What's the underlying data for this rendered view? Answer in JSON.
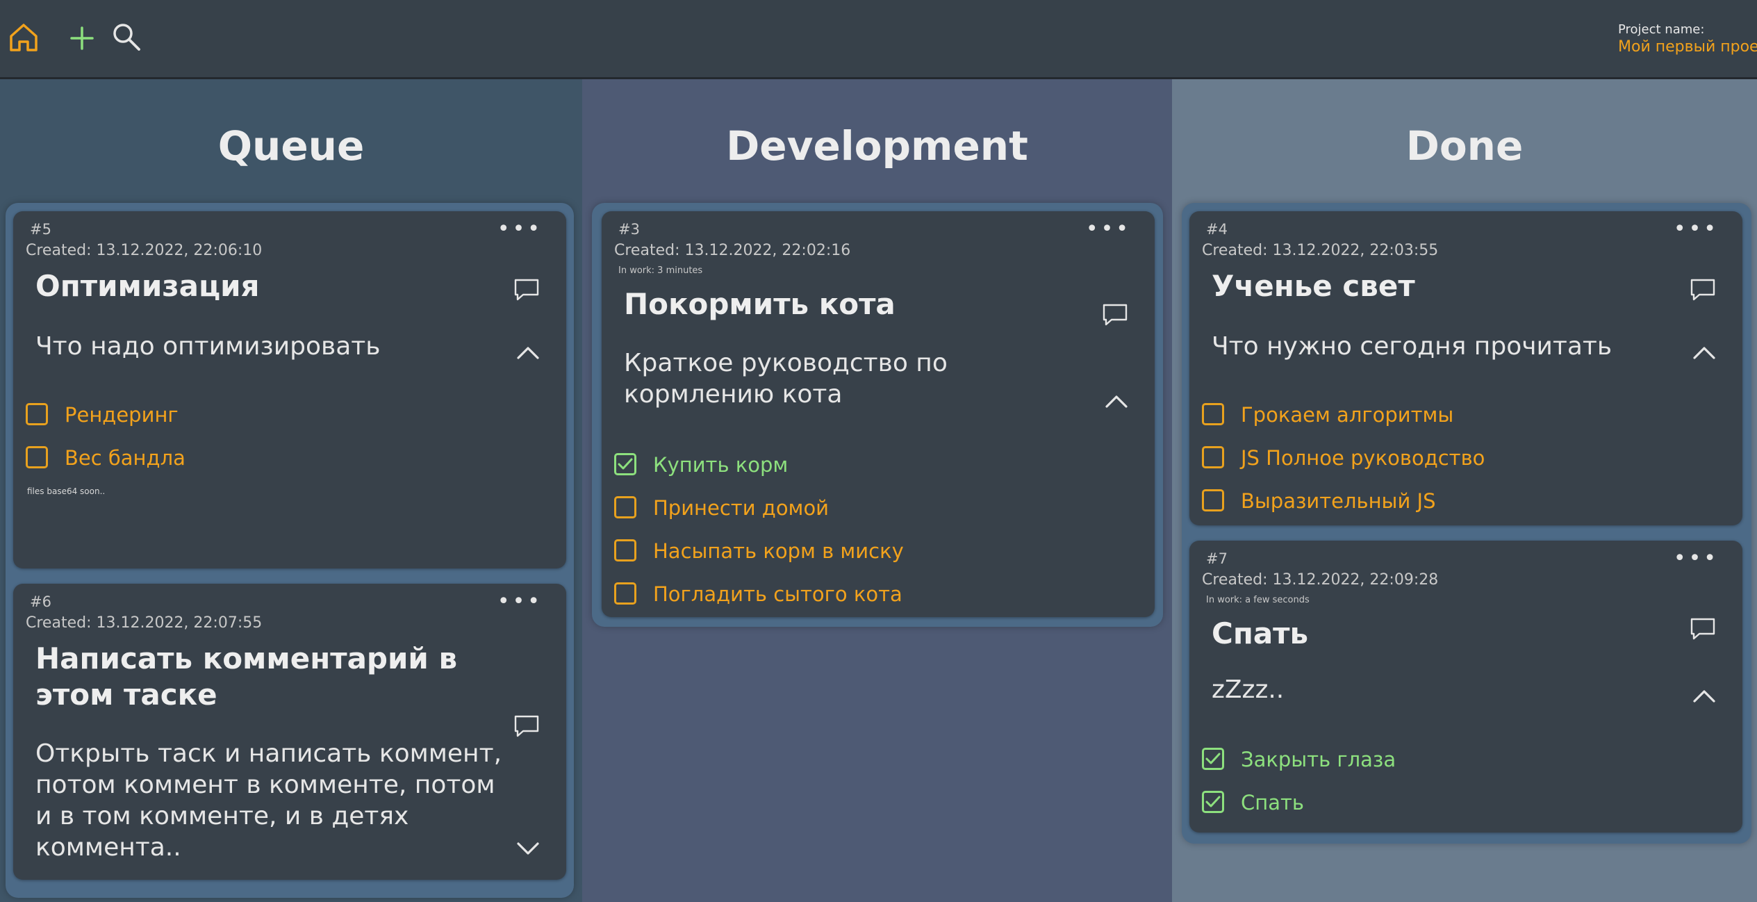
{
  "header": {
    "project_label": "Project name:",
    "project_name": "Мой первый проект"
  },
  "columns": [
    {
      "title": "Queue",
      "cards": [
        {
          "number": "#5",
          "created": "Created: 13.12.2022, 22:06:10",
          "title": "Оптимизация",
          "description": "Что надо оптимизировать",
          "checklist": [
            {
              "label": "Рендеринг",
              "checked": false
            },
            {
              "label": "Вес бандла",
              "checked": false
            }
          ],
          "files_note": "files base64 soon.."
        },
        {
          "number": "#6",
          "created": "Created: 13.12.2022, 22:07:55",
          "title": "Написать комментарий в этом таске",
          "description": "Открыть таск и написать коммент, потом коммент в комменте, потом и в том комменте, и в детях коммента.."
        }
      ]
    },
    {
      "title": "Development",
      "cards": [
        {
          "number": "#3",
          "created": "Created: 13.12.2022, 22:02:16",
          "in_work": "In work: 3 minutes",
          "title": "Покормить кота",
          "description": "Краткое руководство по кормлению кота",
          "checklist": [
            {
              "label": "Купить корм",
              "checked": true
            },
            {
              "label": "Принести домой",
              "checked": false
            },
            {
              "label": "Насыпать корм в миску",
              "checked": false
            },
            {
              "label": "Погладить сытого кота",
              "checked": false
            }
          ]
        }
      ]
    },
    {
      "title": "Done",
      "cards": [
        {
          "number": "#4",
          "created": "Created: 13.12.2022, 22:03:55",
          "title": "Ученье свет",
          "description": "Что нужно сегодня прочитать",
          "checklist": [
            {
              "label": "Грокаем алгоритмы",
              "checked": false
            },
            {
              "label": "JS Полное руководство",
              "checked": false
            },
            {
              "label": "Выразительный JS",
              "checked": false
            }
          ]
        },
        {
          "number": "#7",
          "created": "Created: 13.12.2022, 22:09:28",
          "in_work": "In work: a few seconds",
          "title": "Спать",
          "description": "zZzz..",
          "checklist": [
            {
              "label": "Закрыть глаза",
              "checked": true
            },
            {
              "label": "Спать",
              "checked": true
            }
          ]
        }
      ]
    }
  ],
  "colors": {
    "accent_orange": "#f2a21c",
    "check_green": "#8de07e",
    "card_bg": "#38414a",
    "home_icon": "#f2a21c",
    "add_icon": "#8de07e"
  },
  "icons": [
    "home-icon",
    "plus-icon",
    "search-icon",
    "more-icon",
    "comment-icon",
    "chevron-up-icon",
    "chevron-down-icon",
    "checkbox-icon",
    "checkmark-icon"
  ]
}
